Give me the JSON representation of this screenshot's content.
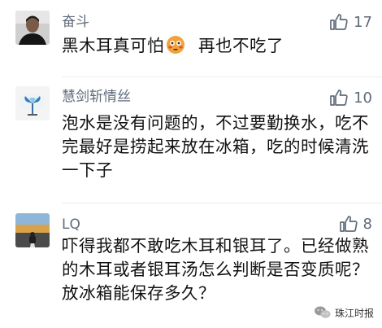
{
  "comments": [
    {
      "username": "奋斗",
      "likes": "17",
      "text_before_emoji": "黑木耳真可怕",
      "emoji": "flushed-face-icon",
      "text_after_emoji": "  再也不吃了"
    },
    {
      "username": "慧剑斩情丝",
      "likes": "10",
      "text": "泡水是没有问题的，不过要勤换水，吃不完最好是捞起来放在冰箱，吃的时候清洗一下子"
    },
    {
      "username": "LQ",
      "likes": "8",
      "text": "吓得我都不敢吃木耳和银耳了。已经做熟的木耳或者银耳汤怎么判断是否变质呢？放冰箱能保存多久？"
    }
  ],
  "watermark": {
    "label": "珠江时报",
    "icon": "wechat-icon"
  },
  "colors": {
    "username": "#5f6b7a",
    "text": "#111111",
    "emoji_face": "#f2a23a",
    "emoji_cheek": "#e0523b"
  }
}
